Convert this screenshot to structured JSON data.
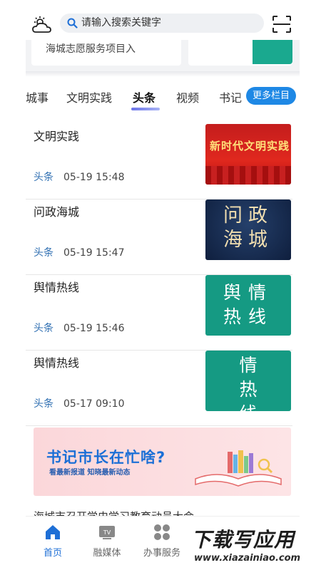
{
  "search": {
    "placeholder": "请输入搜索关键字"
  },
  "top_cards": {
    "card1_label": "海城志愿服务项目入"
  },
  "tabs": [
    {
      "label": "城事"
    },
    {
      "label": "文明实践"
    },
    {
      "label": "头条"
    },
    {
      "label": "视频"
    },
    {
      "label": "书记"
    }
  ],
  "active_tab": "头条",
  "more_columns_label": "更多栏目",
  "news": [
    {
      "title": "文明实践",
      "tag": "头条",
      "time": "05-19 15:48",
      "thumb_text": "新时代文明实践"
    },
    {
      "title": "问政海城",
      "tag": "头条",
      "time": "05-19 15:47",
      "thumb_text_line1": "问政",
      "thumb_text_line2": "海城"
    },
    {
      "title": "舆情热线",
      "tag": "头条",
      "time": "05-19 15:46",
      "thumb_text_line1": "舆情",
      "thumb_text_line2": "热线"
    },
    {
      "title": "舆情热线",
      "tag": "头条",
      "time": "05-17 09:10",
      "thumb_text_line1": "情",
      "thumb_text_line2": "热",
      "thumb_text_line3": "线"
    }
  ],
  "banner": {
    "headline": "书记市长在忙啥?",
    "subline": "看最新报道  知晓最新动态"
  },
  "cutoff_text": "海城市召开学史学习教育动员大会",
  "bottom_nav": [
    {
      "label": "首页"
    },
    {
      "label": "融媒体"
    },
    {
      "label": "办事服务"
    }
  ],
  "watermark": {
    "main": "下载写应用",
    "url": "www.xiazainiao.com"
  },
  "colors": {
    "accent": "#1e88e5",
    "tag": "#2f6fb2",
    "teal": "#159a83",
    "nav_active": "#1e6fd6"
  }
}
